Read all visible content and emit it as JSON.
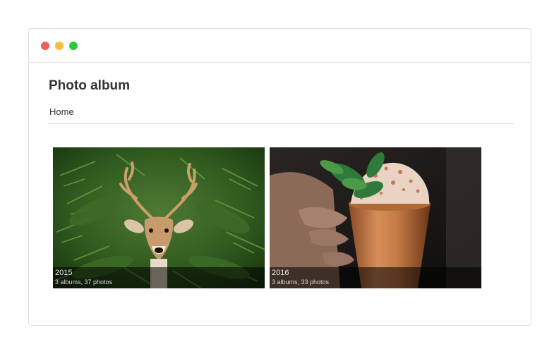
{
  "window": {
    "controls": {
      "close_color": "#ed5f57",
      "minimize_color": "#f6be3b",
      "maximize_color": "#2bc840"
    }
  },
  "page": {
    "title": "Photo album"
  },
  "breadcrumb": {
    "items": [
      {
        "label": "Home"
      }
    ]
  },
  "albums": [
    {
      "title": "2015",
      "subtitle": "3 albums, 37 photos",
      "image": "deer-in-ferns-photo"
    },
    {
      "title": "2016",
      "subtitle": "3 albums, 33 photos",
      "image": "copper-mug-cocktail-photo"
    }
  ]
}
